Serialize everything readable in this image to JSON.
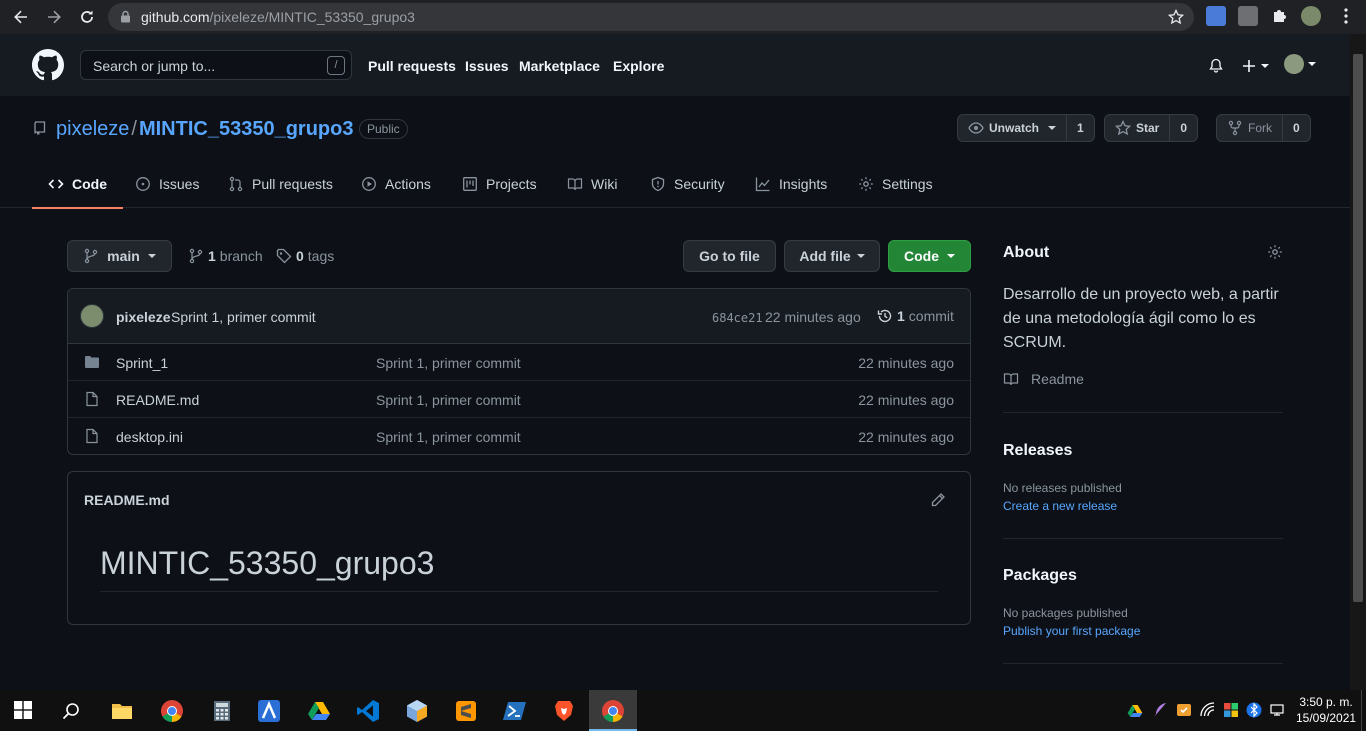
{
  "browser": {
    "url_domain": "github.com",
    "url_path": "/pixeleze/MINTIC_53350_grupo3"
  },
  "header": {
    "search_placeholder": "Search or jump to...",
    "search_shortcut": "/",
    "nav": [
      "Pull requests",
      "Issues",
      "Marketplace",
      "Explore"
    ]
  },
  "repo": {
    "owner": "pixeleze",
    "separator": "/",
    "name": "MINTIC_53350_grupo3",
    "visibility": "Public",
    "watch_label": "Unwatch",
    "watch_count": "1",
    "star_label": "Star",
    "star_count": "0",
    "fork_label": "Fork",
    "fork_count": "0"
  },
  "tabs": [
    {
      "label": "Code",
      "icon": "code-icon",
      "active": true
    },
    {
      "label": "Issues",
      "icon": "issue-icon"
    },
    {
      "label": "Pull requests",
      "icon": "pull-request-icon"
    },
    {
      "label": "Actions",
      "icon": "play-icon"
    },
    {
      "label": "Projects",
      "icon": "project-icon"
    },
    {
      "label": "Wiki",
      "icon": "book-icon"
    },
    {
      "label": "Security",
      "icon": "shield-icon"
    },
    {
      "label": "Insights",
      "icon": "graph-icon"
    },
    {
      "label": "Settings",
      "icon": "gear-icon"
    }
  ],
  "toolbar": {
    "branch": "main",
    "branch_count": "1",
    "branch_word": "branch",
    "tag_count": "0",
    "tag_word": "tags",
    "go_to_file": "Go to file",
    "add_file": "Add file",
    "code": "Code"
  },
  "latest_commit": {
    "author": "pixeleze",
    "message": "Sprint 1, primer commit",
    "sha": "684ce21",
    "age": "22 minutes ago",
    "count": "1",
    "count_word": "commit"
  },
  "files": [
    {
      "type": "folder",
      "name": "Sprint_1",
      "message": "Sprint 1, primer commit",
      "age": "22 minutes ago"
    },
    {
      "type": "file",
      "name": "README.md",
      "message": "Sprint 1, primer commit",
      "age": "22 minutes ago"
    },
    {
      "type": "file",
      "name": "desktop.ini",
      "message": "Sprint 1, primer commit",
      "age": "22 minutes ago"
    }
  ],
  "readme": {
    "filename": "README.md",
    "heading": "MINTIC_53350_grupo3"
  },
  "about": {
    "title": "About",
    "description": "Desarrollo de un proyecto web, a partir de una metodología ágil como lo es SCRUM.",
    "readme_link": "Readme"
  },
  "releases": {
    "title": "Releases",
    "empty": "No releases published",
    "link": "Create a new release"
  },
  "packages": {
    "title": "Packages",
    "empty": "No packages published",
    "link": "Publish your first package"
  },
  "taskbar": {
    "time": "3:50 p. m.",
    "date": "15/09/2021"
  },
  "colors": {
    "bg": "#0d1117",
    "header_bg": "#161b22",
    "link": "#58a6ff",
    "green": "#238636",
    "tab_underline": "#f78166"
  }
}
